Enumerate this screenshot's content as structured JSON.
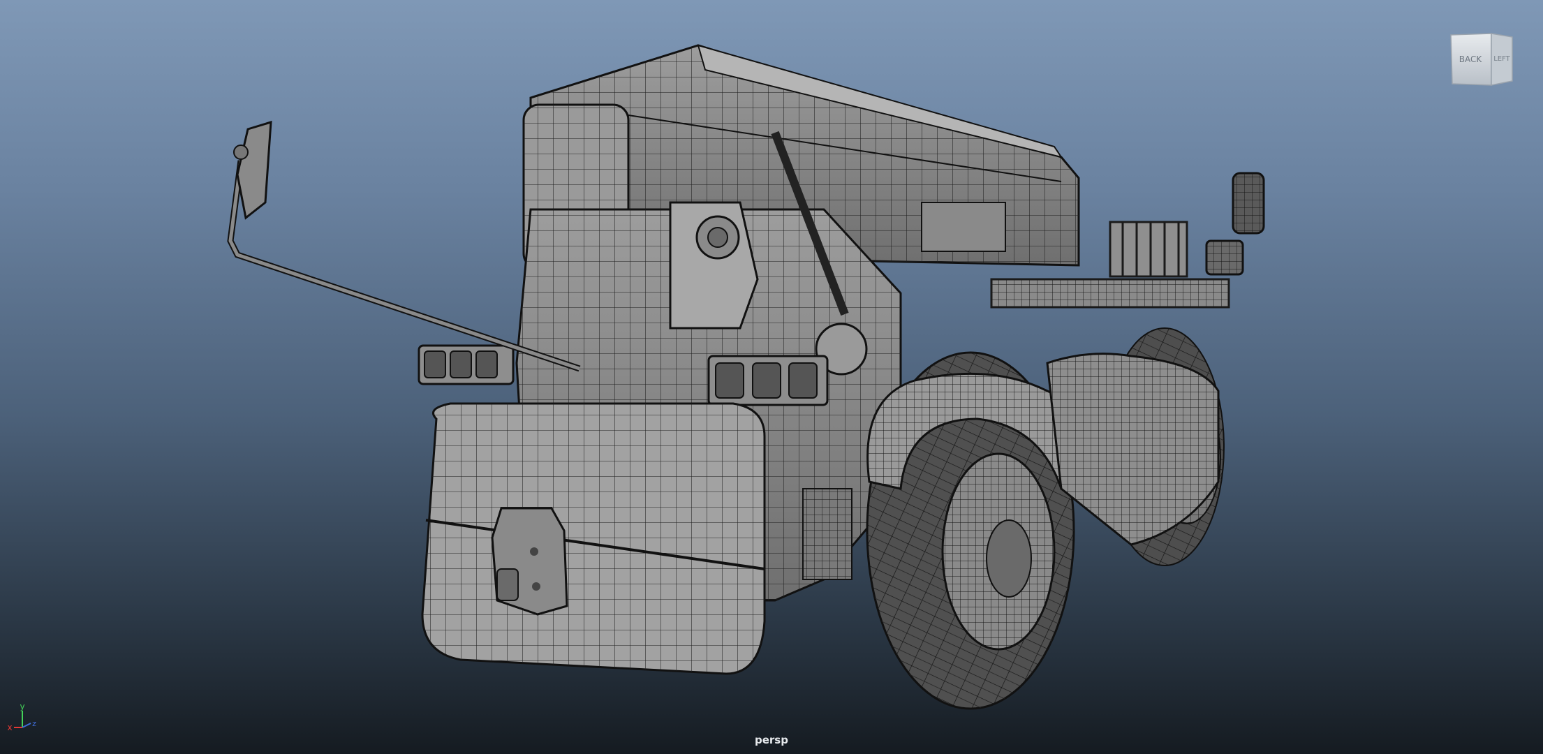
{
  "viewport": {
    "camera_label": "persp",
    "background_top": "#7f98b6",
    "background_bottom": "#151b21",
    "display_mode": "wireframe-on-shaded"
  },
  "viewcube": {
    "front_face_label": "BACK",
    "side_face_label": "LEFT"
  },
  "axis_gizmo": {
    "x_label": "x",
    "y_label": "y",
    "z_label": "z",
    "x_color": "#e53935",
    "y_color": "#43d159",
    "z_color": "#3f6dd8"
  },
  "model": {
    "subject": "telehandler"
  }
}
